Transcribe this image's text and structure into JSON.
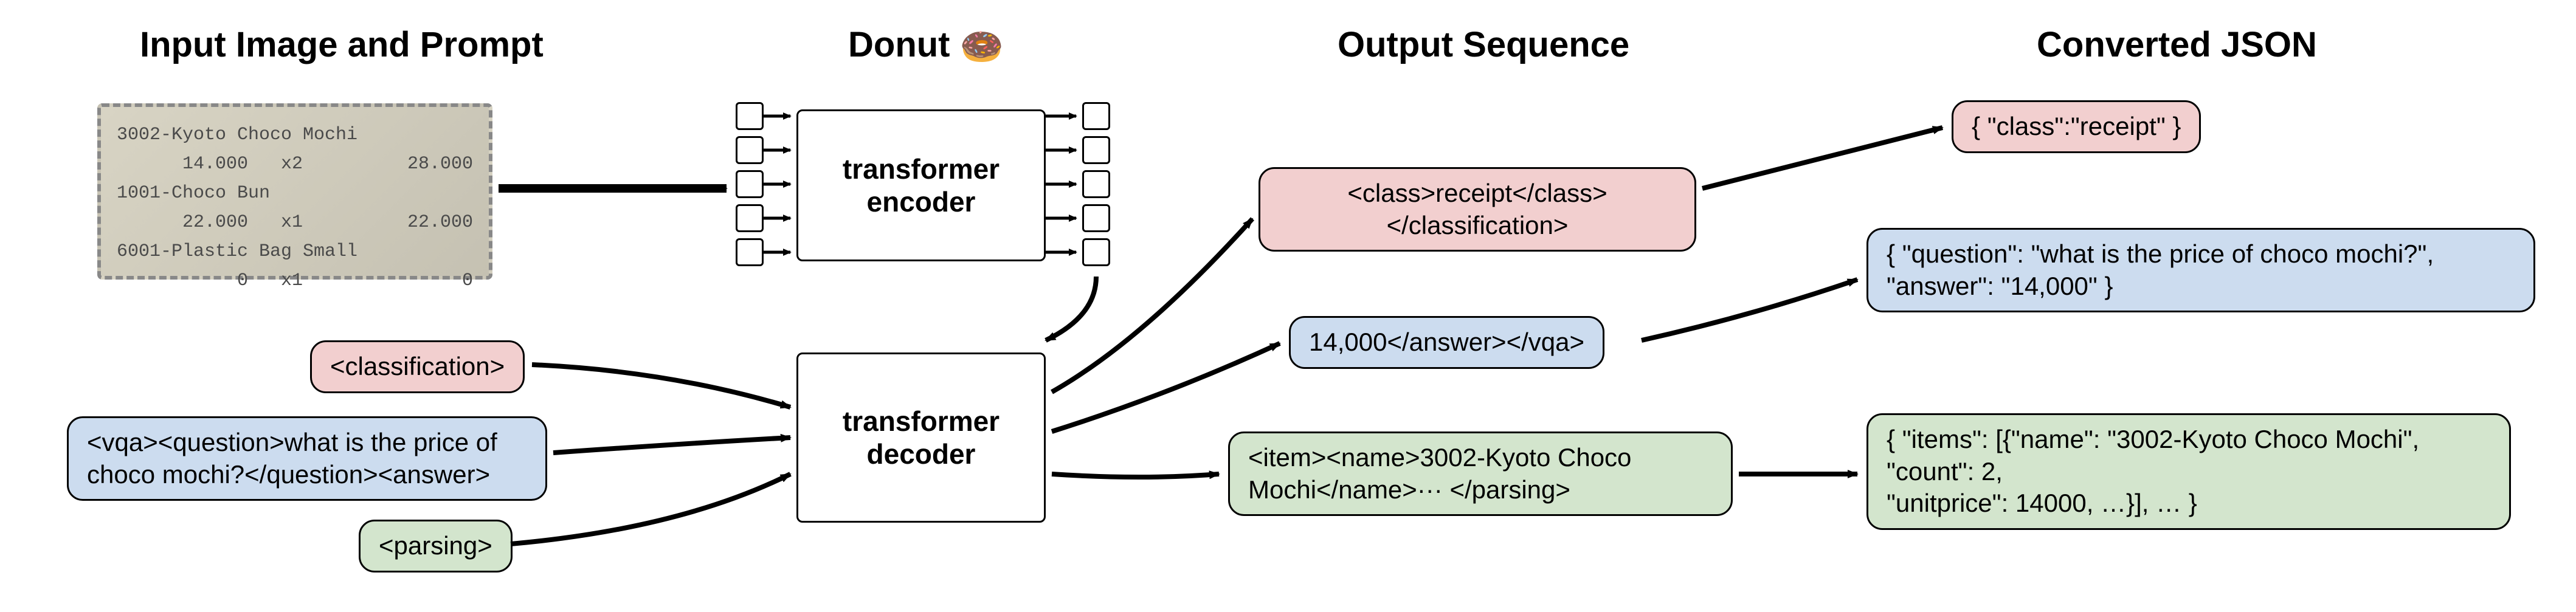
{
  "headings": {
    "input": "Input Image and Prompt",
    "model": "Donut",
    "output": "Output Sequence",
    "json": "Converted JSON"
  },
  "receipt": {
    "lines": [
      {
        "l": "3002-Kyoto Choco Mochi",
        "r": ""
      },
      {
        "l": "      14.000   x2",
        "r": "28.000"
      },
      {
        "l": "1001-Choco Bun",
        "r": ""
      },
      {
        "l": "      22.000   x1",
        "r": "22.000"
      },
      {
        "l": "6001-Plastic Bag Small",
        "r": ""
      },
      {
        "l": "           0   x1",
        "r": "0"
      }
    ]
  },
  "prompts": {
    "classification": "<classification>",
    "vqa": "<vqa><question>what is the price of choco mochi?</question><answer>",
    "parsing": "<parsing>"
  },
  "model": {
    "encoder": "transformer encoder",
    "decoder": "transformer decoder"
  },
  "outputs": {
    "classification": "<class>receipt</class> </classification>",
    "vqa": "14,000</answer></vqa>",
    "parsing": "<item><name>3002-Kyoto Choco Mochi</name>··· </parsing>"
  },
  "json_outputs": {
    "classification": "{ \"class\":\"receipt\" }",
    "vqa_l1": "{ \"question\": \"what is the price of choco mochi?\",",
    "vqa_l2": "  \"answer\": \"14,000\" }",
    "parsing_l1": "{ \"items\": [{\"name\": \"3002-Kyoto Choco Mochi\",",
    "parsing_l2": "     \"count\": 2,",
    "parsing_l3": "     \"unitprice\": 14000, …}], … }"
  },
  "icons": {
    "donut": "🍩"
  }
}
